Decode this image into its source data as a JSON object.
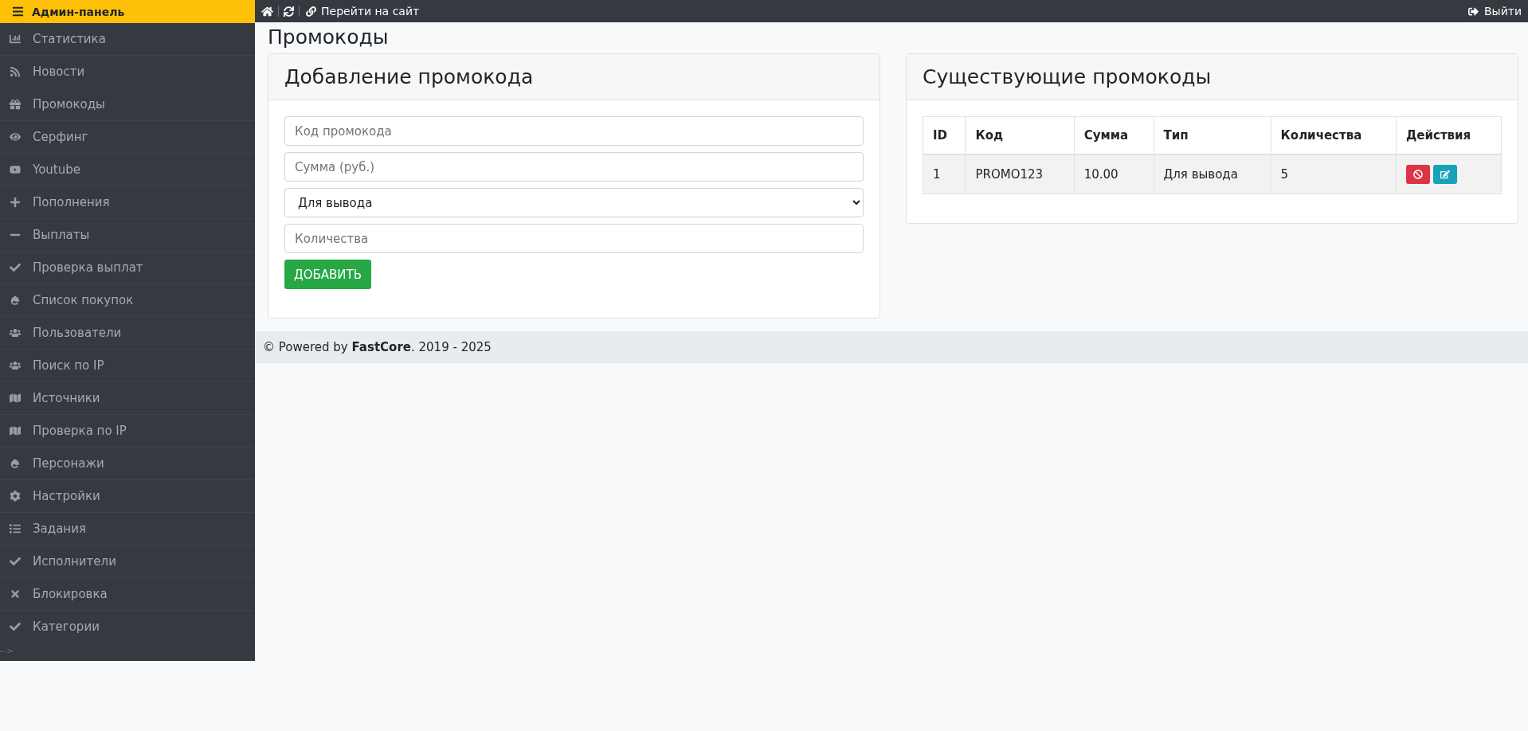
{
  "sidebar": {
    "title": "Админ-панель",
    "items": [
      {
        "label": "Статистика"
      },
      {
        "label": "Новости"
      },
      {
        "label": "Промокоды"
      },
      {
        "label": "Серфинг"
      },
      {
        "label": "Youtube"
      },
      {
        "label": "Пополнения"
      },
      {
        "label": "Выплаты"
      },
      {
        "label": "Проверка выплат"
      },
      {
        "label": "Список покупок"
      },
      {
        "label": "Пользователи"
      },
      {
        "label": "Поиск по IP"
      },
      {
        "label": "Источники"
      },
      {
        "label": "Проверка по IP"
      },
      {
        "label": "Персонажи"
      },
      {
        "label": "Настройки"
      },
      {
        "label": "Задания"
      },
      {
        "label": "Исполнители"
      },
      {
        "label": "Блокировка"
      },
      {
        "label": "Категории"
      }
    ],
    "trailing_text": "-->"
  },
  "topbar": {
    "site_link": "Перейти на сайт",
    "logout": "Выйти"
  },
  "page_title": "Промокоды",
  "add_form": {
    "title": "Добавление промокода",
    "fields": [
      {
        "kind": "input",
        "placeholder": "Код промокода"
      },
      {
        "kind": "input",
        "placeholder": "Сумма (руб.)"
      },
      {
        "kind": "select",
        "value": "Для вывода"
      },
      {
        "kind": "input",
        "placeholder": "Количества"
      }
    ],
    "submit": "ДОБАВИТЬ"
  },
  "promo_table": {
    "title": "Существующие промокоды",
    "columns": [
      "ID",
      "Код",
      "Сумма",
      "Тип",
      "Количества",
      "Действия"
    ],
    "rows": [
      {
        "cells": [
          "1",
          "PROMO123",
          "10.00",
          "Для вывода",
          "5"
        ]
      }
    ]
  },
  "footer": {
    "text": "© Powered by **FastCore**. 2019 - 2025"
  }
}
